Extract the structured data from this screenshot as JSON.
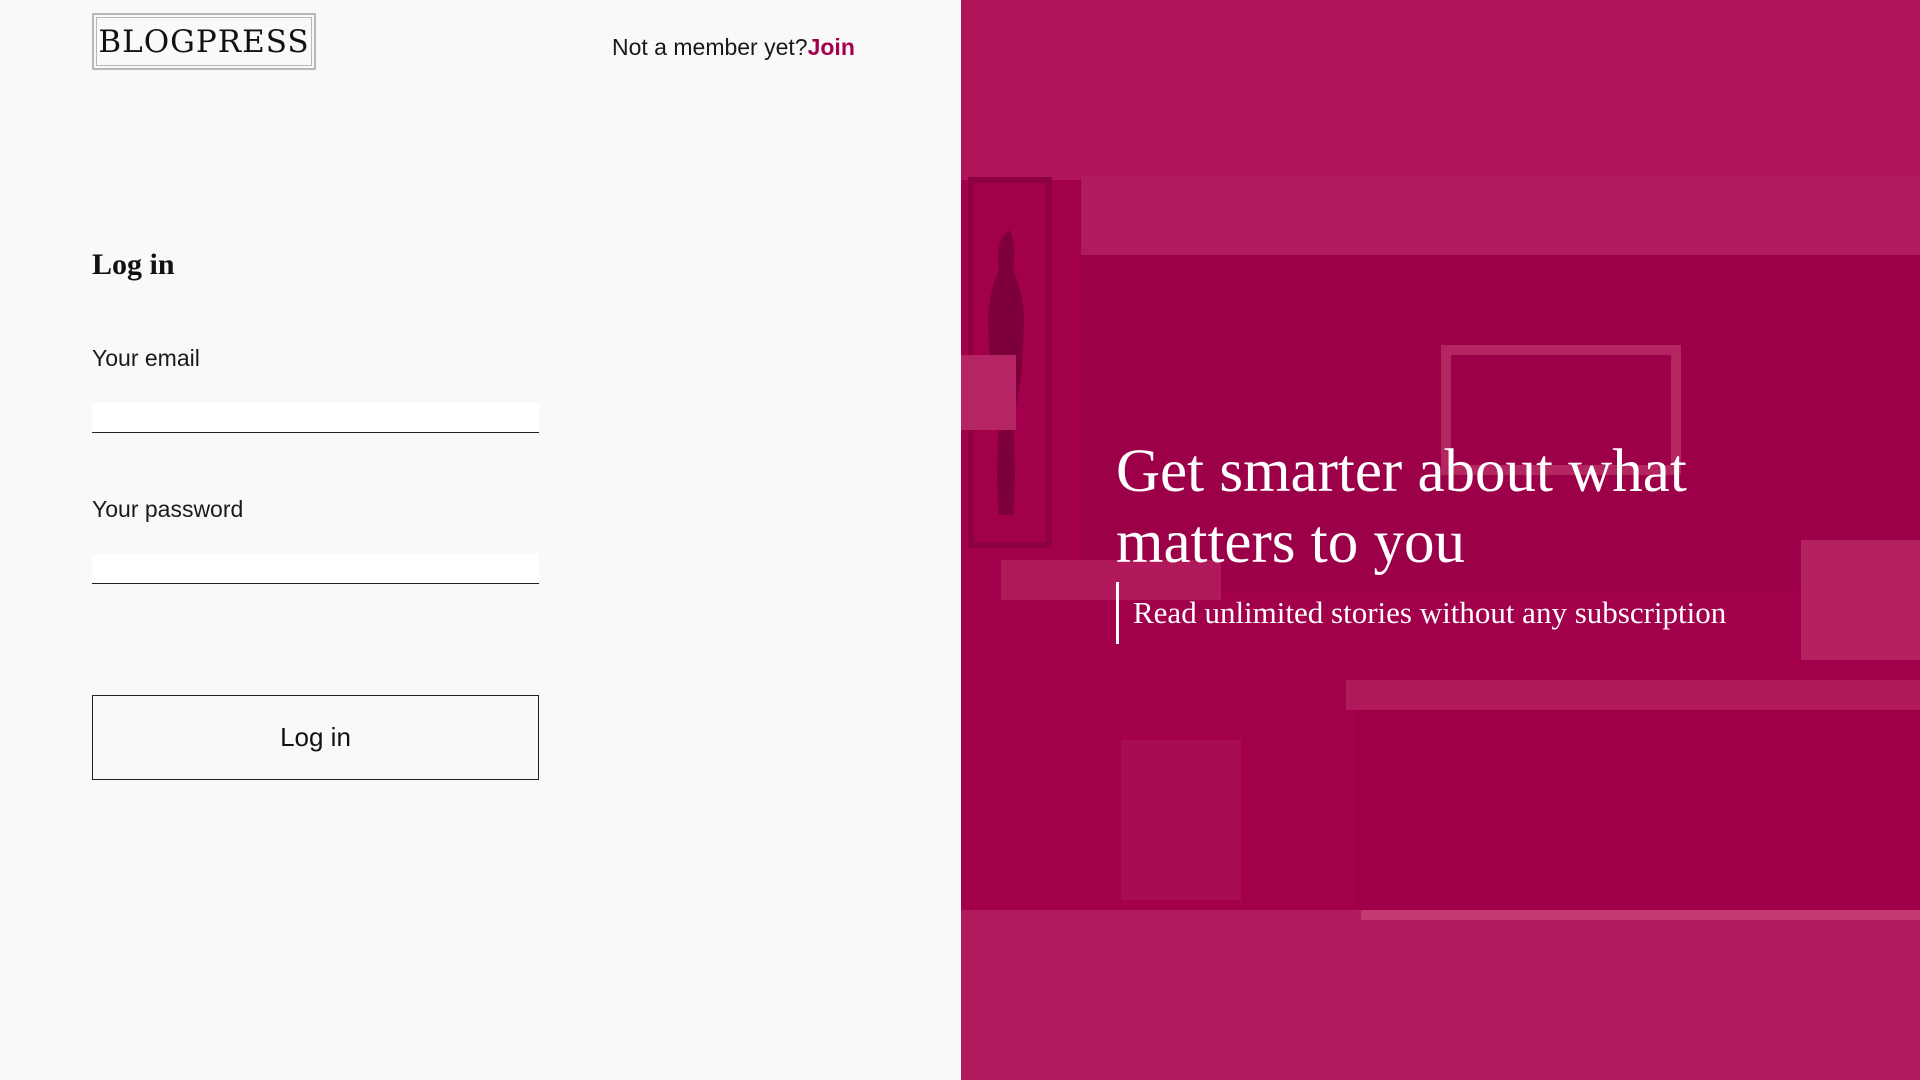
{
  "brand": {
    "logo_text": "BLOGPRESS"
  },
  "header": {
    "prompt_text": "Not a member yet?",
    "join_label": "Join"
  },
  "form": {
    "title": "Log in",
    "email_label": "Your email",
    "email_value": "",
    "password_label": "Your password",
    "password_value": "",
    "submit_label": "Log in"
  },
  "hero": {
    "title": "Get smarter about what matters to you",
    "subtitle": "Read unlimited stories without any subscription",
    "overlay_color": "#a3004c"
  },
  "colors": {
    "accent": "#a5004f",
    "background": "#f9f9f9",
    "text": "#111111"
  }
}
